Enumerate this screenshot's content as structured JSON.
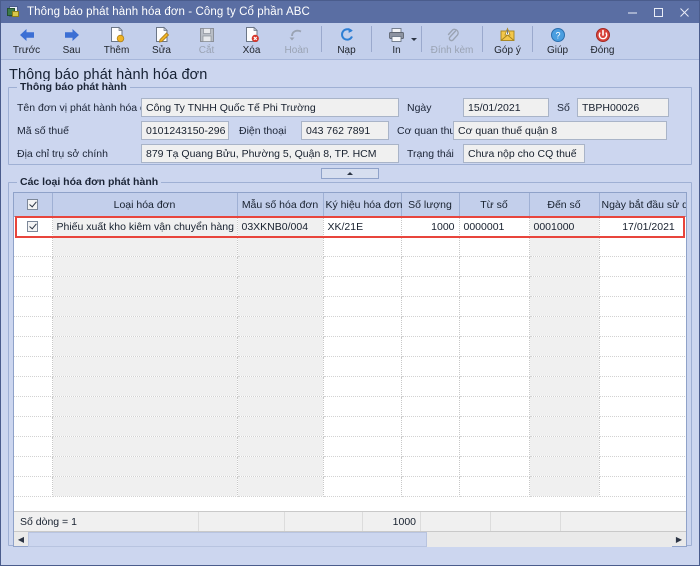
{
  "window": {
    "title": "Thông báo phát hành hóa đơn - Công ty Cổ phần ABC",
    "icon": "invoice-document-icon",
    "minimize_label": "–",
    "maximize_label": "▢",
    "close_label": "✕"
  },
  "toolbar": {
    "items": [
      {
        "label": "Trước",
        "icon": "arrow-left-icon",
        "disabled": false
      },
      {
        "label": "Sau",
        "icon": "arrow-right-icon",
        "disabled": false
      },
      {
        "label": "Thêm",
        "icon": "page-add-icon",
        "disabled": false
      },
      {
        "label": "Sửa",
        "icon": "page-edit-icon",
        "disabled": false
      },
      {
        "label": "Cắt",
        "icon": "floppy-save-icon",
        "disabled": true
      },
      {
        "label": "Xóa",
        "icon": "page-delete-icon",
        "disabled": false
      },
      {
        "label": "Hoàn",
        "icon": "undo-icon",
        "disabled": true
      },
      {
        "label": "Nạp",
        "icon": "refresh-icon",
        "disabled": false
      },
      {
        "label": "In",
        "icon": "printer-icon",
        "disabled": false,
        "has_dropdown": true
      },
      {
        "label": "Đính kèm",
        "icon": "paperclip-icon",
        "disabled": true
      },
      {
        "label": "Góp ý",
        "icon": "envelope-icon",
        "disabled": false
      },
      {
        "label": "Giúp",
        "icon": "help-circle-icon",
        "disabled": false
      },
      {
        "label": "Đóng",
        "icon": "power-close-icon",
        "disabled": false
      }
    ]
  },
  "page": {
    "heading": "Thông báo phát hành hóa đơn"
  },
  "announcement_group": {
    "title": "Thông báo phát hành",
    "fields": {
      "issuer_name_label": "Tên đơn vị phát hành hóa đơn",
      "issuer_name_value": "Công Ty TNHH Quốc Tế Phi Trường",
      "date_label": "Ngày",
      "date_value": "15/01/2021",
      "number_label": "Số",
      "number_value": "TBPH00026",
      "tax_code_label": "Mã số thuế",
      "tax_code_value": "0101243150-296",
      "phone_label": "Điện thoại",
      "phone_value": "043 762 7891",
      "tax_office_label": "Cơ quan thuế",
      "tax_office_value": "Cơ quan thuế quận 8",
      "address_label": "Địa chỉ trụ sở chính",
      "address_value": "879 Tạ Quang Bửu, Phường 5, Quận 8, TP. HCM",
      "status_label": "Trạng thái",
      "status_value": "Chưa nộp cho CQ thuế"
    }
  },
  "collapse_toggle": {
    "name": "collapse-panel-toggle",
    "glyph": "▲"
  },
  "invoice_types_group": {
    "title": "Các loại hóa đơn phát hành",
    "columns": [
      {
        "key": "check",
        "label": ""
      },
      {
        "key": "loai_hoa_don",
        "label": "Loại hóa đơn"
      },
      {
        "key": "mau_so",
        "label": "Mẫu số hóa đơn"
      },
      {
        "key": "ky_hieu",
        "label": "Ký hiệu hóa đơn"
      },
      {
        "key": "so_luong",
        "label": "Số lượng"
      },
      {
        "key": "tu_so",
        "label": "Từ số"
      },
      {
        "key": "den_so",
        "label": "Đến số"
      },
      {
        "key": "ngay_bat_dau",
        "label": "Ngày bắt đầu sử dụng"
      }
    ],
    "header_checkbox_checked": true,
    "rows": [
      {
        "checked": true,
        "loai_hoa_don": "Phiếu xuất kho kiêm vận chuyển hàng hóa nội b",
        "mau_so": "03XKNB0/004",
        "ky_hieu": "XK/21E",
        "so_luong": "1000",
        "tu_so": "0000001",
        "den_so": "0001000",
        "ngay_bat_dau": "17/01/2021",
        "selected": true
      }
    ],
    "empty_row_count": 13,
    "summary": {
      "row_count_label": "Số dòng = 1",
      "so_luong_total": "1000"
    }
  },
  "colors": {
    "window_bg": "#ccd6ef",
    "titlebar": "#5a6ea3",
    "toolbar": "#c3cfeb",
    "header_row": "#c3cfeb",
    "selection_outline": "#e8453c",
    "field_bg": "#f0f0f0",
    "grid_border": "#8fa2c9"
  }
}
